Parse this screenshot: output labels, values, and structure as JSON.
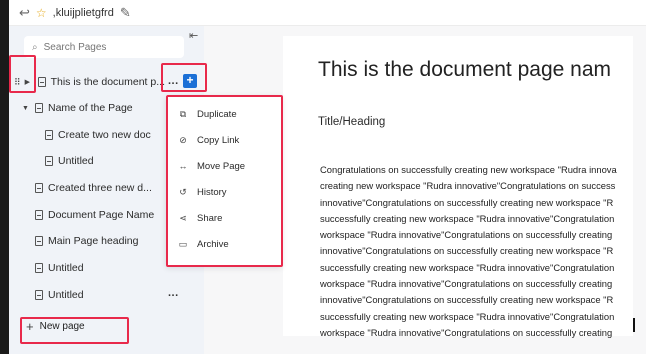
{
  "breadcrumb": {
    "workspace_name": ",kluijplietgfrd"
  },
  "sidebar": {
    "search_placeholder": "Search Pages",
    "items": [
      {
        "label": "This is the document p..."
      },
      {
        "label": "Name of the Page"
      },
      {
        "label": "Create two new doc"
      },
      {
        "label": "Untitled"
      },
      {
        "label": "Created three new d..."
      },
      {
        "label": "Document Page Name"
      },
      {
        "label": "Main Page heading"
      },
      {
        "label": "Untitled"
      },
      {
        "label": "Untitled"
      }
    ],
    "more_label": "...",
    "add_label": "+",
    "new_page_label": "New page"
  },
  "context_menu": {
    "items": [
      {
        "label": "Duplicate",
        "icon": "duplicate-icon"
      },
      {
        "label": "Copy Link",
        "icon": "link-icon"
      },
      {
        "label": "Move Page",
        "icon": "move-icon"
      },
      {
        "label": "History",
        "icon": "history-icon"
      },
      {
        "label": "Share",
        "icon": "share-icon"
      },
      {
        "label": "Archive",
        "icon": "archive-icon"
      }
    ]
  },
  "document": {
    "title": "This is the document page nam",
    "subheading": "Title/Heading",
    "body_lines": [
      "Congratulations on successfully creating new workspace \"Rudra innova",
      "creating new workspace \"Rudra innovative\"Congratulations on success",
      "innovative\"Congratulations on successfully creating new workspace \"R",
      "successfully creating new workspace \"Rudra innovative\"Congratulation",
      "workspace \"Rudra innovative\"Congratulations on successfully creating",
      "innovative\"Congratulations on successfully creating new workspace \"R",
      "successfully creating new workspace \"Rudra innovative\"Congratulation",
      "workspace \"Rudra innovative\"Congratulations on successfully creating",
      "innovative\"Congratulations on successfully creating new workspace \"R",
      "successfully creating new workspace \"Rudra innovative\"Congratulation",
      "workspace \"Rudra innovative\"Congratulations on successfully creating"
    ]
  },
  "colors": {
    "highlight": "#e8294b",
    "accent": "#1b6fd6",
    "sidebar_bg": "#f0f3f8"
  }
}
